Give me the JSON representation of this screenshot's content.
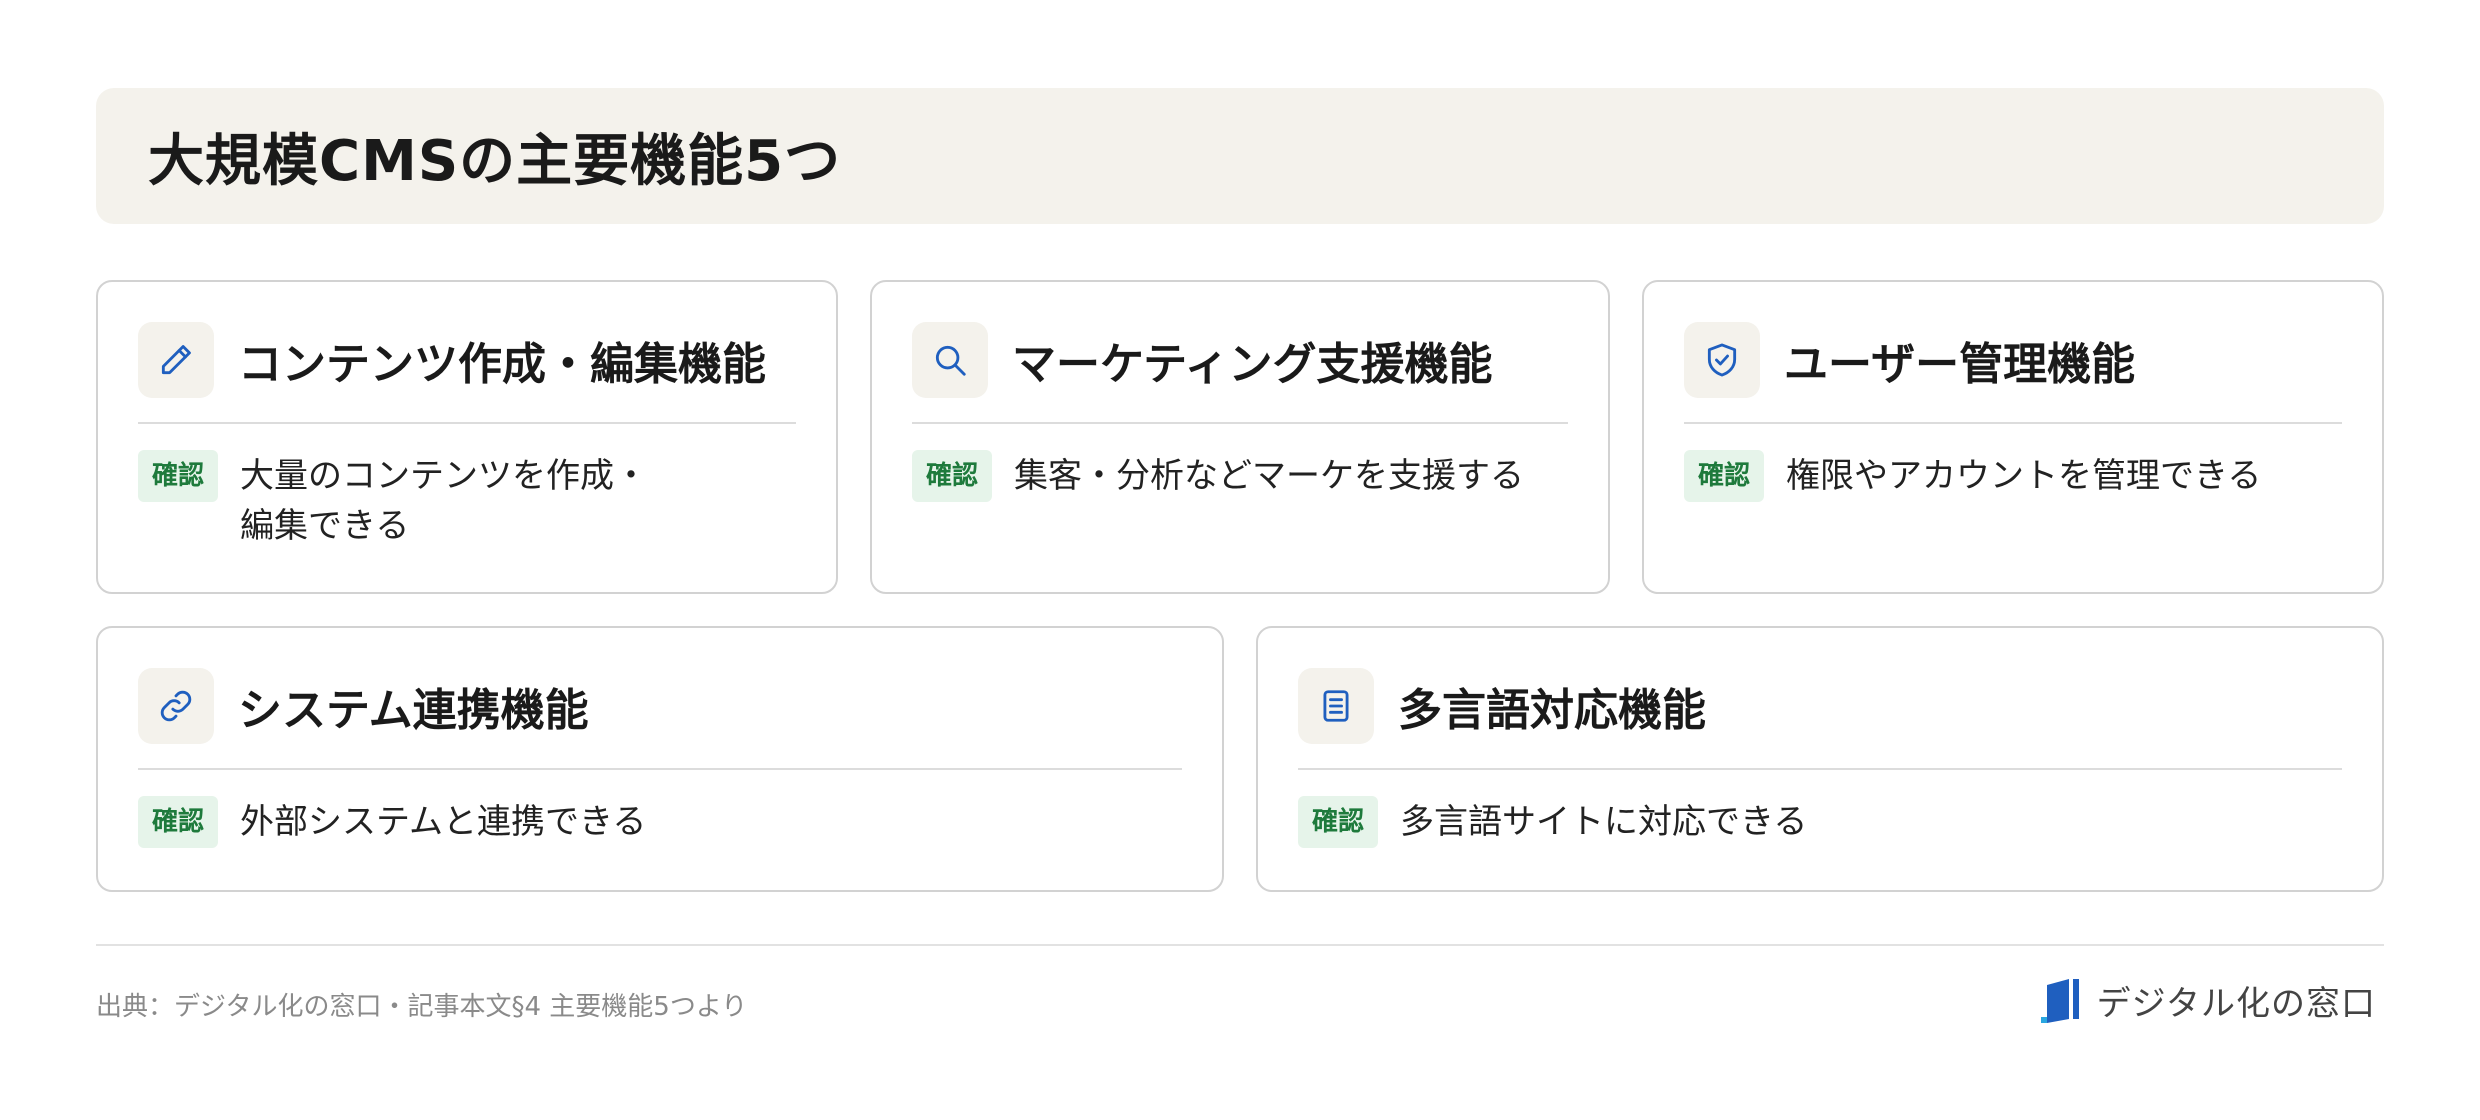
{
  "title": "大規模CMSの主要機能5つ",
  "cards": [
    {
      "icon": "pencil-icon",
      "title": "コンテンツ作成・編集機能",
      "badge": "確認",
      "desc_line1": "大量のコンテンツを作成・",
      "desc_line2": "編集できる"
    },
    {
      "icon": "search-icon",
      "title": "マーケティング支援機能",
      "badge": "確認",
      "desc": "集客・分析などマーケを支援する"
    },
    {
      "icon": "shield-check-icon",
      "title": "ユーザー管理機能",
      "badge": "確認",
      "desc": "権限やアカウントを管理できる"
    },
    {
      "icon": "link-icon",
      "title": "システム連携機能",
      "badge": "確認",
      "desc": "外部システムと連携できる"
    },
    {
      "icon": "document-icon",
      "title": "多言語対応機能",
      "badge": "確認",
      "desc": "多言語サイトに対応できる"
    }
  ],
  "footer": {
    "source": "出典：デジタル化の窓口・記事本文§4 主要機能5つより",
    "logo_text": "デジタル化の窓口"
  },
  "colors": {
    "accent": "#1f5fbf",
    "badge_bg": "#e6f4ea",
    "badge_text": "#1e7a3c",
    "banner_bg": "#f4f2ec"
  }
}
